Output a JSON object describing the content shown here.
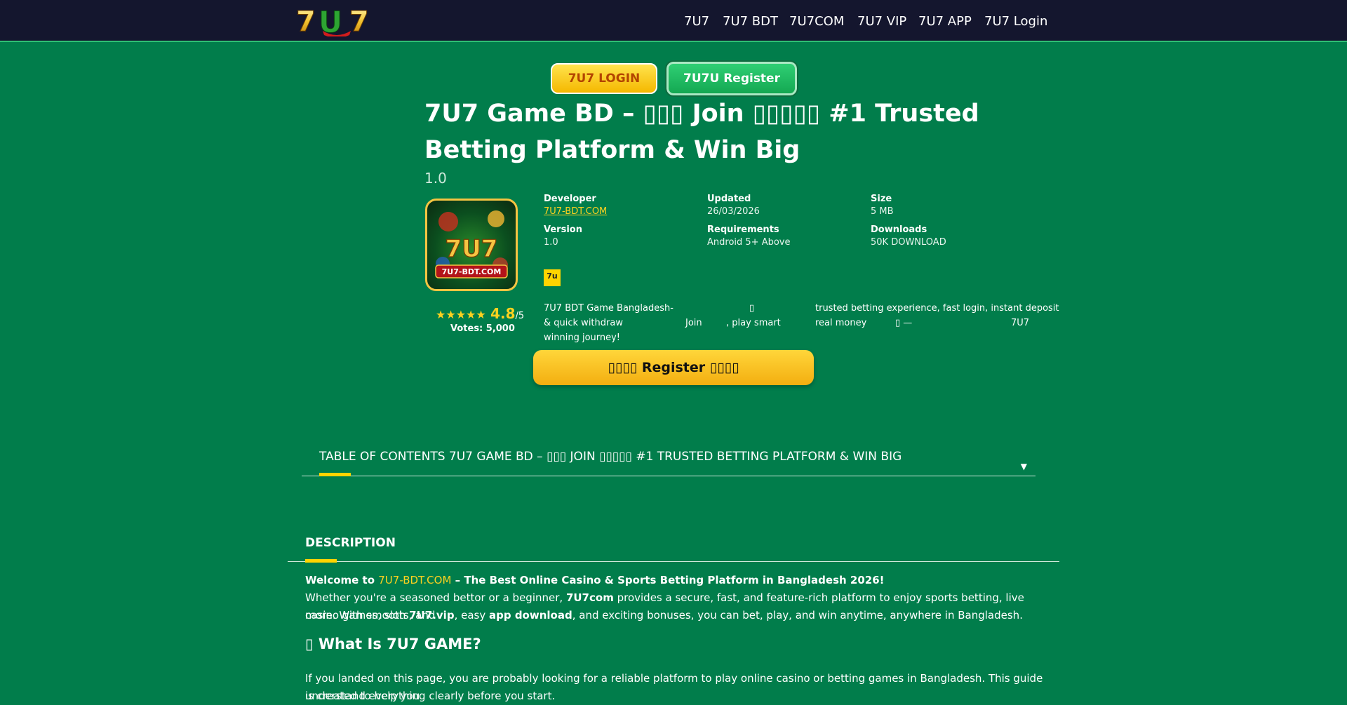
{
  "header": {
    "logo_text": "7U7",
    "nav": [
      "7U7",
      "7U7 BDT",
      "7U7COM",
      "7U7 VIP",
      "7U7 APP",
      "7U7 Login"
    ]
  },
  "buttons": {
    "login": "7U7 LOGIN",
    "register": "7U7U Register"
  },
  "app": {
    "title": "7U7 Game BD – ▯▯▯ Join ▯▯▯▯▯ #1 Trusted Betting Platform & Win Big",
    "version_display": "1.0",
    "icon_text": "7U7",
    "icon_site": "7U7-BDT.COM",
    "rating_value": "4.8",
    "rating_max": "/5",
    "rating_stars": "★★★★★",
    "votes": "Votes: 5,000",
    "meta": {
      "developer_label": "Developer",
      "developer_value": "7U7-BDT.COM",
      "updated_label": "Updated",
      "updated_value": "26/03/2026",
      "size_label": "Size",
      "size_value": "5 MB",
      "version_label": "Version",
      "version_value": "1.0",
      "requirements_label": "Requirements",
      "requirements_value": "Android 5+ Above",
      "downloads_label": "Downloads",
      "downloads_value": "50K DOWNLOAD"
    },
    "badge": "7u",
    "desc": {
      "l1a": "7U7 BDT Game Bangladesh-",
      "l1b": "▯",
      "l1c": "trusted betting experience, fast login, instant deposit",
      "l2a": "& quick withdraw",
      "l2b": "Join",
      "l2c": ", play smart",
      "l2d": "real money",
      "l2e": "▯ —",
      "l2f": "7U7",
      "l3a": "winning journey!"
    },
    "big_register": "▯▯▯▯ Register ▯▯▯▯"
  },
  "toc": {
    "title": "TABLE OF CONTENTS 7U7 GAME BD – ▯▯▯ JOIN ▯▯▯▯▯ #1 TRUSTED BETTING PLATFORM & WIN BIG",
    "arrow": "▼"
  },
  "description": {
    "heading": "DESCRIPTION",
    "welcome_pre": "Welcome to ",
    "welcome_link": "7U7-BDT.COM",
    "welcome_post": " – The Best Online Casino & Sports Betting Platform in Bangladesh 2026!",
    "p1a": "Whether you're a seasoned bettor or a beginner, ",
    "p1b": "7U7com",
    "p1c": " provides a secure, fast, and feature-rich platform to enjoy sports betting, live casino games, slots, and",
    "p2a": "more. With smooth ",
    "p2b": "7U7.vip",
    "p2c": ", easy ",
    "p2d": "app download",
    "p2e": ", and exciting bonuses, you can bet, play, and win anytime, anywhere in Bangladesh.",
    "h2": "▯ What Is 7U7 GAME?",
    "p3": "If you landed on this page, you are probably looking for a reliable platform to play online casino or betting games in Bangladesh. This guide is created to help you",
    "p4": "understand everything clearly before you start."
  }
}
